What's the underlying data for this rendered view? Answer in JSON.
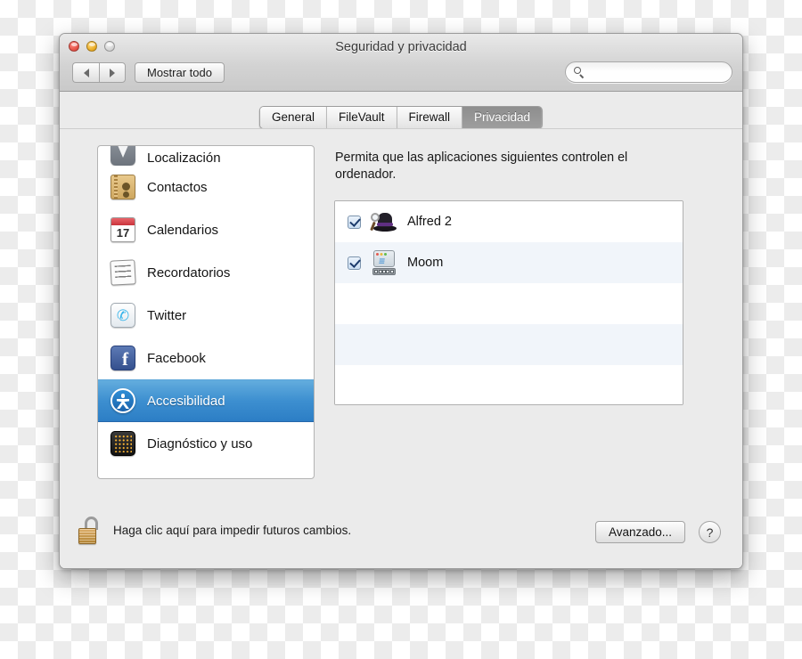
{
  "window": {
    "title": "Seguridad y privacidad",
    "controls": {
      "close": "close-button",
      "minimize": "minimize-button",
      "zoom": "zoom-button"
    },
    "toolbar": {
      "back_label": "◀",
      "forward_label": "▶",
      "show_all_label": "Mostrar todo",
      "search_value": "",
      "search_placeholder": ""
    }
  },
  "tabs": [
    {
      "label": "General",
      "selected": false
    },
    {
      "label": "FileVault",
      "selected": false
    },
    {
      "label": "Firewall",
      "selected": false
    },
    {
      "label": "Privacidad",
      "selected": true
    }
  ],
  "sidebar": {
    "items": [
      {
        "label": "Localización",
        "icon": "location-icon",
        "selected": false,
        "clipped": true
      },
      {
        "label": "Contactos",
        "icon": "contacts-icon",
        "selected": false
      },
      {
        "label": "Calendarios",
        "icon": "calendar-icon",
        "icon_text": "17",
        "selected": false
      },
      {
        "label": "Recordatorios",
        "icon": "reminders-icon",
        "selected": false
      },
      {
        "label": "Twitter",
        "icon": "twitter-icon",
        "icon_text": "✆",
        "selected": false
      },
      {
        "label": "Facebook",
        "icon": "facebook-icon",
        "icon_text": "f",
        "selected": false
      },
      {
        "label": "Accesibilidad",
        "icon": "accessibility-icon",
        "selected": true
      },
      {
        "label": "Diagnóstico y uso",
        "icon": "diagnostics-icon",
        "selected": false
      }
    ]
  },
  "panel": {
    "description": "Permita que las aplicaciones siguientes controlen el ordenador.",
    "apps": [
      {
        "name": "Alfred 2",
        "checked": true,
        "icon": "alfred-icon"
      },
      {
        "name": "Moom",
        "checked": true,
        "icon": "moom-icon",
        "icon_text": "≡"
      }
    ],
    "empty_rows": 3
  },
  "footer": {
    "lock_state": "unlocked",
    "lock_text": "Haga clic aquí para impedir futuros cambios.",
    "advanced_label": "Avanzado...",
    "help_label": "?"
  },
  "colors": {
    "selection_blue": "#3d8fd0",
    "window_chrome": "#ebebeb",
    "tab_active": "#9e9e9e",
    "row_stripe": "#f1f5fa"
  }
}
